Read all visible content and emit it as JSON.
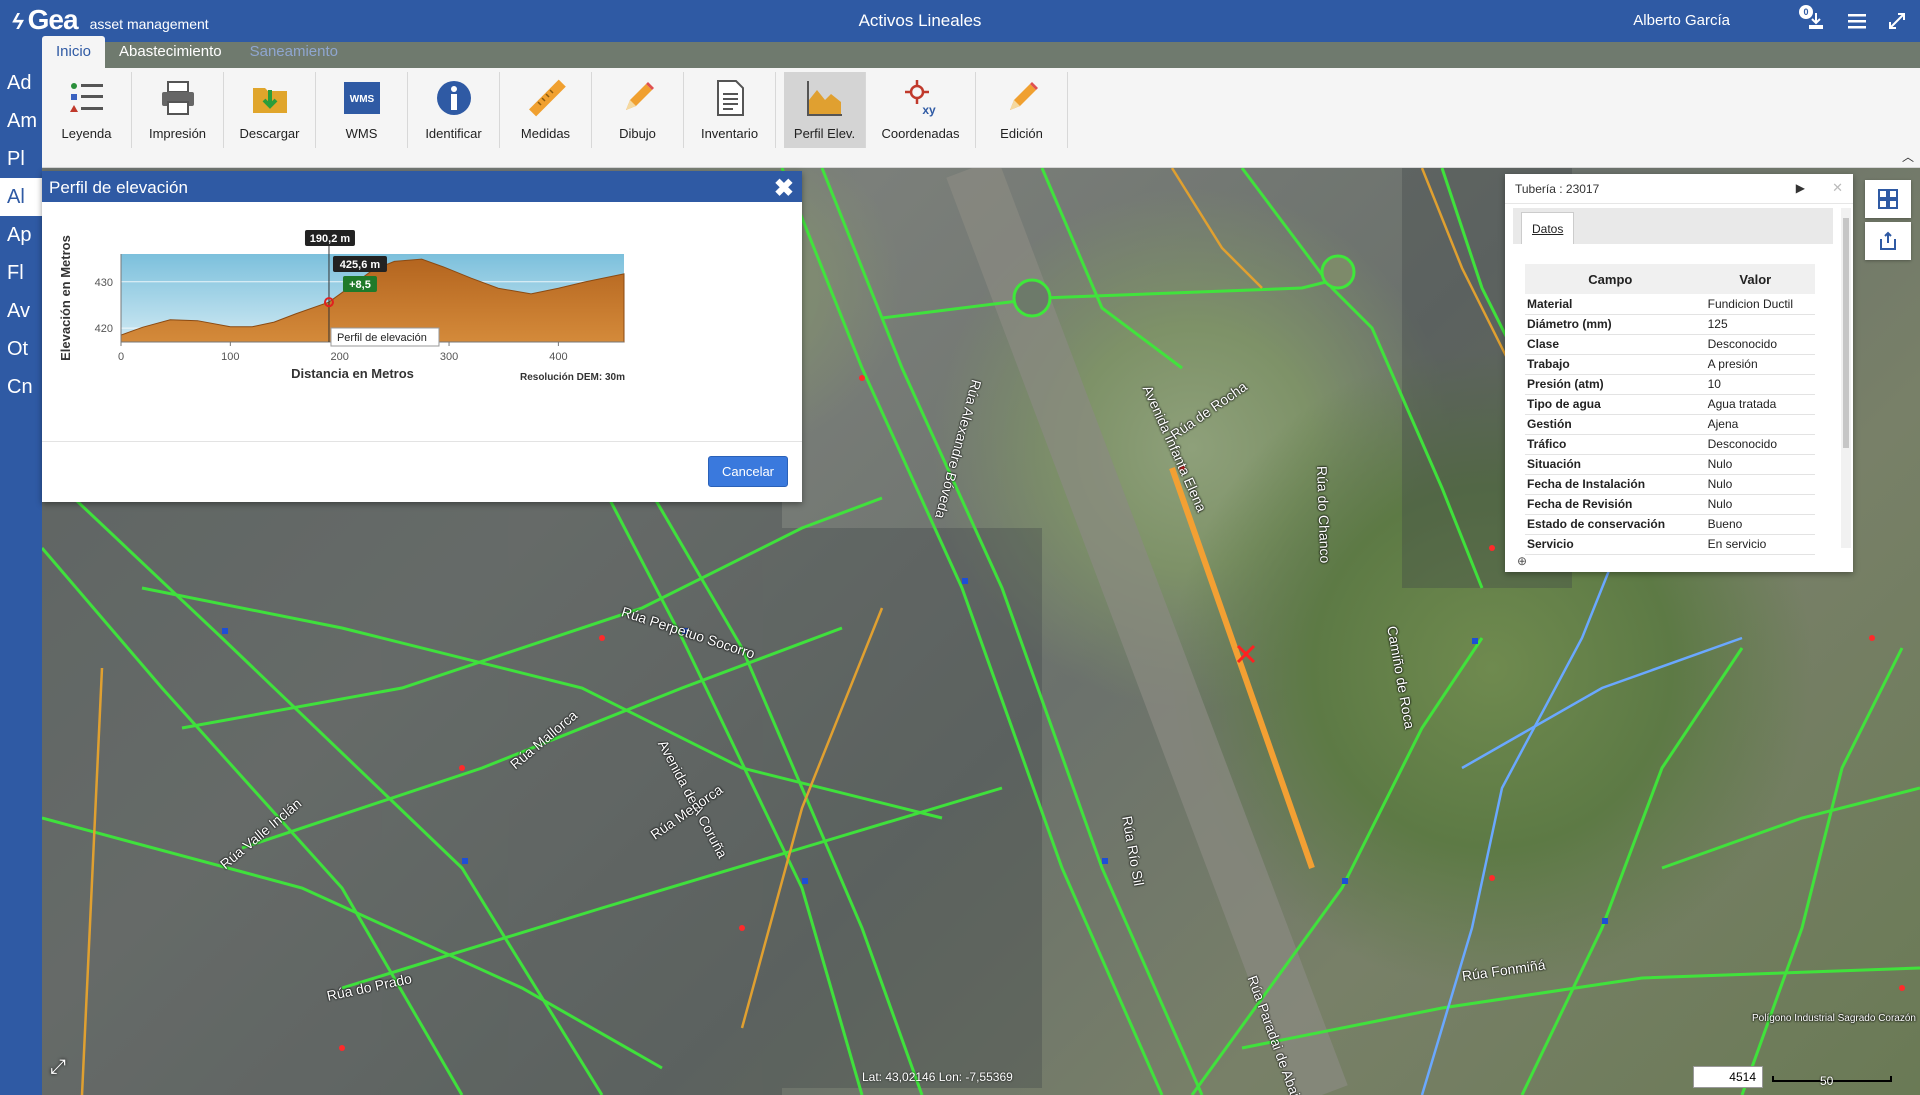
{
  "app": {
    "logo_word": "Gea",
    "logo_sub": "asset management",
    "title": "Activos Lineales",
    "user": "Alberto García",
    "notification_count": "0"
  },
  "tabs": [
    {
      "label": "Inicio"
    },
    {
      "label": "Abastecimiento"
    },
    {
      "label": "Saneamiento"
    }
  ],
  "leftrail": [
    "Ad",
    "Am",
    "Pl",
    "Al",
    "Ap",
    "Fl",
    "Av",
    "Ot",
    "Cn"
  ],
  "ribbon": [
    {
      "label": "Leyenda",
      "icon": "legend-icon"
    },
    {
      "label": "Impresión",
      "icon": "printer-icon"
    },
    {
      "label": "Descargar",
      "icon": "download-folder-icon"
    },
    {
      "label": "WMS",
      "icon": "wms-icon"
    },
    {
      "label": "Identificar",
      "icon": "info-icon"
    },
    {
      "label": "Medidas",
      "icon": "ruler-icon"
    },
    {
      "label": "Dibujo",
      "icon": "pencil-icon"
    },
    {
      "label": "Inventario",
      "icon": "document-icon"
    },
    {
      "label": "Perfil Elev.",
      "icon": "elevation-profile-icon"
    },
    {
      "label": "Coordenadas",
      "icon": "coordinates-xy-icon"
    },
    {
      "label": "Edición",
      "icon": "edit-pencil-icon"
    }
  ],
  "elevation_dialog": {
    "title": "Perfil de elevación",
    "cancel_label": "Cancelar",
    "resolution_note": "Resolución DEM: 30m",
    "tooltip_distance": "190,2 m",
    "tooltip_elevation": "425,6 m",
    "tooltip_delta": "+8,5",
    "tooltip_series": "Perfil de elevación"
  },
  "chart_data": {
    "type": "area",
    "xlabel": "Distancia en Metros",
    "ylabel": "Elevación en Metros",
    "xlim": [
      0,
      460
    ],
    "ylim": [
      417,
      436
    ],
    "x_ticks": [
      0,
      100,
      200,
      300,
      400
    ],
    "y_ticks": [
      420,
      430
    ],
    "series": [
      {
        "name": "Perfil de elevación",
        "x": [
          0,
          20,
          45,
          70,
          100,
          120,
          140,
          160,
          190,
          210,
          230,
          250,
          275,
          295,
          320,
          345,
          375,
          400,
          425,
          460
        ],
        "y": [
          418.5,
          420.2,
          421.8,
          421.6,
          420.3,
          420.3,
          421.3,
          423.1,
          425.6,
          429.0,
          432.5,
          434.4,
          434.9,
          433.2,
          430.8,
          428.6,
          427.4,
          428.6,
          430.0,
          431.7
        ]
      }
    ],
    "highlight": {
      "x": 190.2,
      "y": 425.6,
      "delta": "+8,5"
    }
  },
  "info_panel": {
    "title": "Tubería : 23017",
    "tab_label": "Datos",
    "columns": [
      "Campo",
      "Valor"
    ],
    "rows": [
      [
        "Material",
        "Fundicion Ductil"
      ],
      [
        "Diámetro (mm)",
        "125"
      ],
      [
        "Clase",
        "Desconocido"
      ],
      [
        "Trabajo",
        "A presión"
      ],
      [
        "Presión (atm)",
        "10"
      ],
      [
        "Tipo de agua",
        "Agua tratada"
      ],
      [
        "Gestión",
        "Ajena"
      ],
      [
        "Tráfico",
        "Desconocido"
      ],
      [
        "Situación",
        "Nulo"
      ],
      [
        "Fecha de Instalación",
        "Nulo"
      ],
      [
        "Fecha de Revisión",
        "Nulo"
      ],
      [
        "Estado de conservación",
        "Bueno"
      ],
      [
        "Servicio",
        "En servicio"
      ]
    ]
  },
  "map": {
    "coords": "Lat: 43,02146  Lon: -7,55369",
    "scale_value": "4514",
    "scale_unit": "50",
    "street_labels": [
      "Avenida de A Coruña",
      "Avenida Infanta Elena",
      "Rúa Alexandre Bóveda",
      "Rúa Valle Inclán",
      "Rúa Perpetuo Socorro",
      "Rúa do Prado",
      "Rúa de Rocha",
      "Camiño de Roca",
      "Rúa do Chanco",
      "Rúa Río Sil",
      "Rúa Paradai de Abaixo",
      "Rúa Mallorca",
      "Rúa Menorca",
      "Rúa Fonmiñá",
      "Polígono Industrial Sagrado Corazón"
    ]
  }
}
